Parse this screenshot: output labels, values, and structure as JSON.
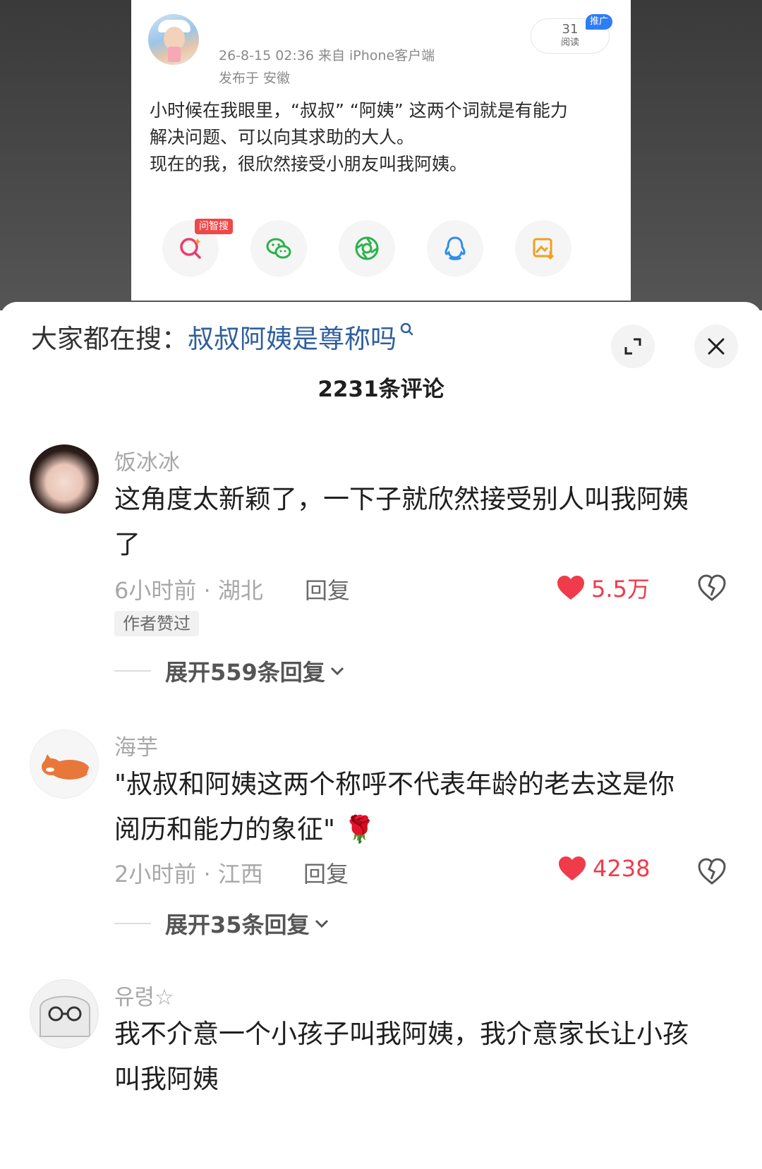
{
  "post": {
    "meta": "26-8-15 02:36  来自 iPhone客户端",
    "location": "发布于 安徽",
    "read_count": "31",
    "read_label": "阅读",
    "promo_tag": "推广",
    "text_lines": [
      "小时候在我眼里，“叔叔” “阿姨” 这两个词就是有能力",
      "解决问题、可以向其求助的大人。",
      "现在的我，很欣然接受小朋友叫我阿姨。"
    ],
    "zhisou_tag": "问智搜",
    "share_icons": [
      "zhisou-icon",
      "wechat-icon",
      "moments-icon",
      "qq-icon",
      "save-image-icon"
    ]
  },
  "search": {
    "label": "大家都在搜：",
    "keyword": "叔叔阿姨是尊称吗"
  },
  "header": {
    "comment_count": "2231条评论"
  },
  "comments": [
    {
      "name": "饭冰冰",
      "text_lines": [
        "这角度太新颖了，一下子就欣然接受别人叫我阿姨",
        "了"
      ],
      "time_loc": "6小时前 · 湖北",
      "reply_label": "回复",
      "likes": "5.5万",
      "author_tag": "作者赞过",
      "expand_label": "展开559条回复"
    },
    {
      "name": "海芋",
      "text_lines": [
        "\"叔叔和阿姨这两个称呼不代表年龄的老去这是你",
        "阅历和能力的象征\" 🌹"
      ],
      "time_loc": "2小时前 · 江西",
      "reply_label": "回复",
      "likes": "4238",
      "expand_label": "展开35条回复"
    },
    {
      "name": "유령☆",
      "text_lines": [
        "我不介意一个小孩子叫我阿姨，我介意家长让小孩",
        "叫我阿姨"
      ]
    }
  ],
  "colors": {
    "like_red": "#ef3b4a",
    "keyword_blue": "#2f5f9c",
    "promo_blue": "#2f7df6"
  }
}
